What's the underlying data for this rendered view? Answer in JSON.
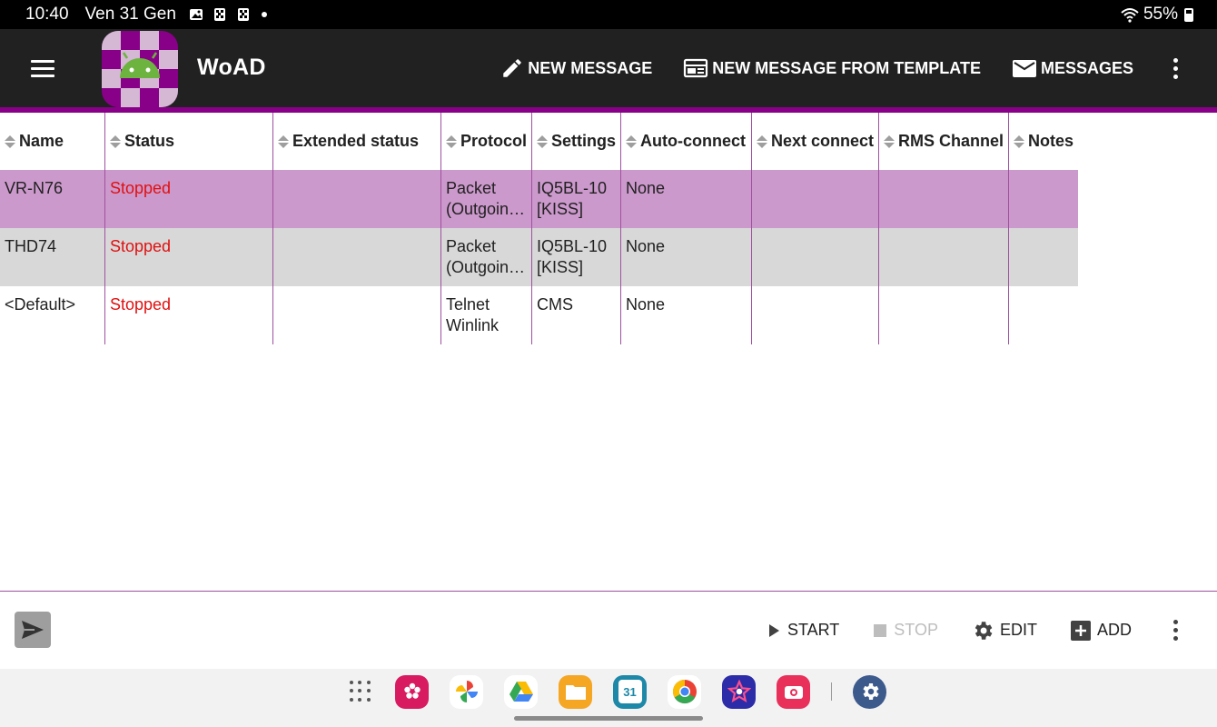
{
  "status_bar": {
    "time": "10:40",
    "date": "Ven 31 Gen",
    "battery": "55%"
  },
  "app_bar": {
    "title": "WoAD",
    "actions": [
      {
        "label": "NEW MESSAGE",
        "icon": "pencil-icon"
      },
      {
        "label": "NEW MESSAGE FROM TEMPLATE",
        "icon": "template-icon"
      },
      {
        "label": "MESSAGES",
        "icon": "envelope-icon"
      }
    ]
  },
  "table": {
    "columns": [
      "Name",
      "Status",
      "Extended status",
      "Protocol",
      "Settings",
      "Auto-connect",
      "Next connect",
      "RMS Channel",
      "Notes"
    ],
    "rows": [
      {
        "name": "VR-N76",
        "status": "Stopped",
        "extended_status": "",
        "protocol_line1": "Packet",
        "protocol_line2": "(Outgoin…",
        "settings_line1": "IQ5BL-10",
        "settings_line2": "[KISS]",
        "auto_connect": "None",
        "next_connect": "",
        "rms_channel": "",
        "notes": ""
      },
      {
        "name": "THD74",
        "status": "Stopped",
        "extended_status": "",
        "protocol_line1": "Packet",
        "protocol_line2": "(Outgoin…",
        "settings_line1": "IQ5BL-10",
        "settings_line2": "[KISS]",
        "auto_connect": "None",
        "next_connect": "",
        "rms_channel": "",
        "notes": ""
      },
      {
        "name": "<Default>",
        "status": "Stopped",
        "extended_status": "",
        "protocol_line1": "Telnet",
        "protocol_line2": "Winlink",
        "settings_line1": "CMS",
        "settings_line2": "",
        "auto_connect": "None",
        "next_connect": "",
        "rms_channel": "",
        "notes": ""
      }
    ]
  },
  "toolbar": {
    "start_label": "START",
    "stop_label": "STOP",
    "edit_label": "EDIT",
    "add_label": "ADD"
  },
  "colors": {
    "accent": "#880088",
    "selected_row": "#cc99cc",
    "alt_row": "#d8d8d8",
    "stopped": "#e01010",
    "app_bar": "#212121"
  }
}
